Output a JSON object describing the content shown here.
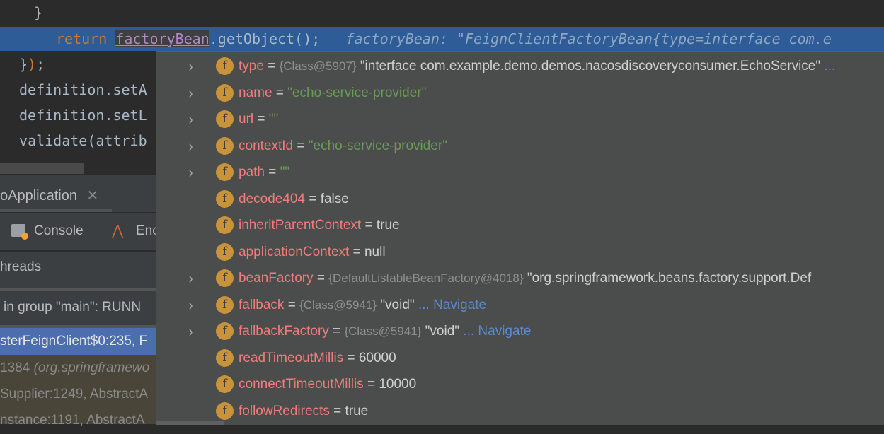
{
  "editor": {
    "lines": [
      {
        "text": "    }"
      },
      {
        "keyword": "return",
        "variable": "factoryBean",
        "rest": ".getObject();",
        "hint": "factoryBean: \"FeignClientFactoryBean{type=interface com.e"
      },
      {
        "text": "});"
      },
      {
        "text": "definition.setA"
      },
      {
        "text": "definition.setL"
      },
      {
        "text": "validate(attrib"
      }
    ]
  },
  "tool_window": {
    "run_tab": "oApplication",
    "close_glyph": "✕",
    "toolbar": {
      "console": "Console",
      "endpoints": "Enc"
    },
    "threads_label": "hreads",
    "thread_selector": "in group \"main\": RUNN",
    "frames": [
      {
        "text": "sterFeignClient$0:235, F",
        "selected": true
      },
      {
        "text": "1384 ",
        "italic": "(org.springframewo"
      },
      {
        "text": "Supplier:1249, AbstractA"
      },
      {
        "text": "nstance:1191, AbstractA"
      }
    ]
  },
  "popup": {
    "variables": [
      {
        "name": "type",
        "expandable": true,
        "ref": "{Class@5907}",
        "value": "\"interface com.example.demo.demos.nacosdiscoveryconsumer.EchoService\"",
        "extra": " ..."
      },
      {
        "name": "name",
        "expandable": true,
        "str": "\"echo-service-provider\""
      },
      {
        "name": "url",
        "expandable": true,
        "str": "\"\""
      },
      {
        "name": "contextId",
        "expandable": true,
        "str": "\"echo-service-provider\""
      },
      {
        "name": "path",
        "expandable": true,
        "str": "\"\""
      },
      {
        "name": "decode404",
        "expandable": false,
        "value": "false"
      },
      {
        "name": "inheritParentContext",
        "expandable": false,
        "value": "true"
      },
      {
        "name": "applicationContext",
        "expandable": false,
        "value": "null"
      },
      {
        "name": "beanFactory",
        "expandable": true,
        "ref": "{DefaultListableBeanFactory@4018}",
        "value": "\"org.springframework.beans.factory.support.Def"
      },
      {
        "name": "fallback",
        "expandable": true,
        "ref": "{Class@5941}",
        "value": "\"void\"",
        "extra": " ... Navigate"
      },
      {
        "name": "fallbackFactory",
        "expandable": true,
        "ref": "{Class@5941}",
        "value": "\"void\"",
        "extra": " ... Navigate"
      },
      {
        "name": "readTimeoutMillis",
        "expandable": false,
        "value": "60000"
      },
      {
        "name": "connectTimeoutMillis",
        "expandable": false,
        "value": "10000"
      },
      {
        "name": "followRedirects",
        "expandable": false,
        "value": "true"
      }
    ],
    "field_icon_glyph": "f",
    "chevron_glyph": "›"
  },
  "colors": {
    "editor_bg": "#2b2b2b",
    "highlight": "#2d5c96",
    "popup_bg": "#4b4d4d",
    "field_name": "#f07c7c",
    "string": "#6a9b55",
    "navigate": "#5c8ad1",
    "field_icon": "#c9933c"
  }
}
